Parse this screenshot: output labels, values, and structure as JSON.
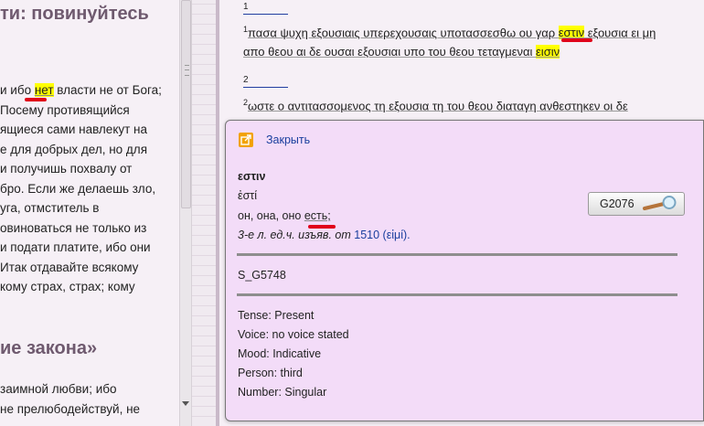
{
  "left": {
    "heading_top": "ти: повинуйтесь",
    "lines": [
      [
        "и ибо ",
        "нет",
        " власти не от Бога;"
      ],
      [
        "Посему противящийся"
      ],
      [
        "ящиеся сами навлекут на"
      ],
      [
        "е для добрых дел, но для"
      ],
      [
        " и получишь похвалу от"
      ],
      [
        "бро. Если же делаешь зло,"
      ],
      [
        "уга, отмститель в"
      ],
      [
        "овиноваться не только из"
      ],
      [
        "и подати платите, ибо они"
      ],
      [
        " Итак отдавайте всякому"
      ],
      [
        "кому страх, страх; кому"
      ]
    ],
    "heading_bottom": "ие закона»",
    "lines_bottom": [
      "заимной любви; ибо",
      " не прелюбодействуй, не"
    ]
  },
  "right": {
    "verse1": {
      "num": "1",
      "sup": "1",
      "pre": "πασα ψυχη εξουσιαις υπερεχουσαις υποτασσεσθω ου γαρ ",
      "hl": "εστιν",
      "mid": " εξουσια ει μη",
      "line2": "απο θεου αι δε ουσαι εξουσιαι υπο του θεου τεταγμεναι ",
      "hl2": "εισιν"
    },
    "verse2": {
      "num": "2",
      "sup": "2",
      "text": "ωστε ο αντιτασσομενος τη εξουσια τη του θεου διαταγη ανθεστηκεν οι δε"
    }
  },
  "popup": {
    "close_label": "Закрыть",
    "word": "εστιν",
    "lemma": "ἐστί",
    "translation_pre": "он, она, оно ",
    "translation_word": "есть;",
    "grammar_pre": "3-е л. ед.ч. изъяв. от ",
    "grammar_link": "1510 (εἰμί).",
    "strong_label": "G2076",
    "code": "S_G5748",
    "tense": "Tense: Present",
    "voice": "Voice: no voice stated",
    "mood": "Mood: Indicative",
    "person": "Person: third",
    "number": "Number: Singular"
  },
  "colors": {
    "highlight": "#ffff00",
    "red_mark": "#e0001a",
    "popup_bg": "#f3dcf8",
    "link": "#1a3f9e"
  }
}
